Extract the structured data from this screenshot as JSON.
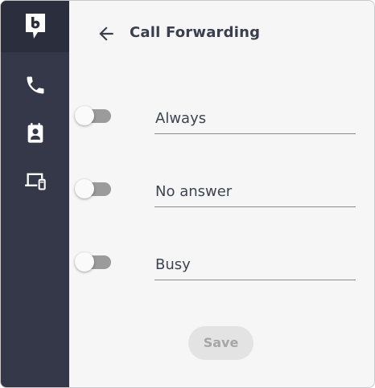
{
  "app": {
    "brand_icon": "b-speech-bubble-logo"
  },
  "sidebar": {
    "items": [
      {
        "icon": "phone-icon",
        "label": "Phone"
      },
      {
        "icon": "contacts-icon",
        "label": "Contacts"
      },
      {
        "icon": "devices-icon",
        "label": "Devices"
      }
    ]
  },
  "header": {
    "back_icon": "arrow-left-icon",
    "title": "Call Forwarding"
  },
  "forwarding": [
    {
      "label": "Always",
      "enabled": false
    },
    {
      "label": "No answer",
      "enabled": false
    },
    {
      "label": "Busy",
      "enabled": false
    }
  ],
  "actions": {
    "save_label": "Save",
    "save_enabled": false
  },
  "colors": {
    "sidebar_bg": "#343848",
    "logo_bg": "#2b2f3d",
    "main_bg": "#f6f6f6",
    "toggle_track_off": "#9b9b9b",
    "text": "#3a3f4f",
    "save_disabled_bg": "#e3e3e3",
    "save_disabled_text": "#a6a6a6"
  }
}
